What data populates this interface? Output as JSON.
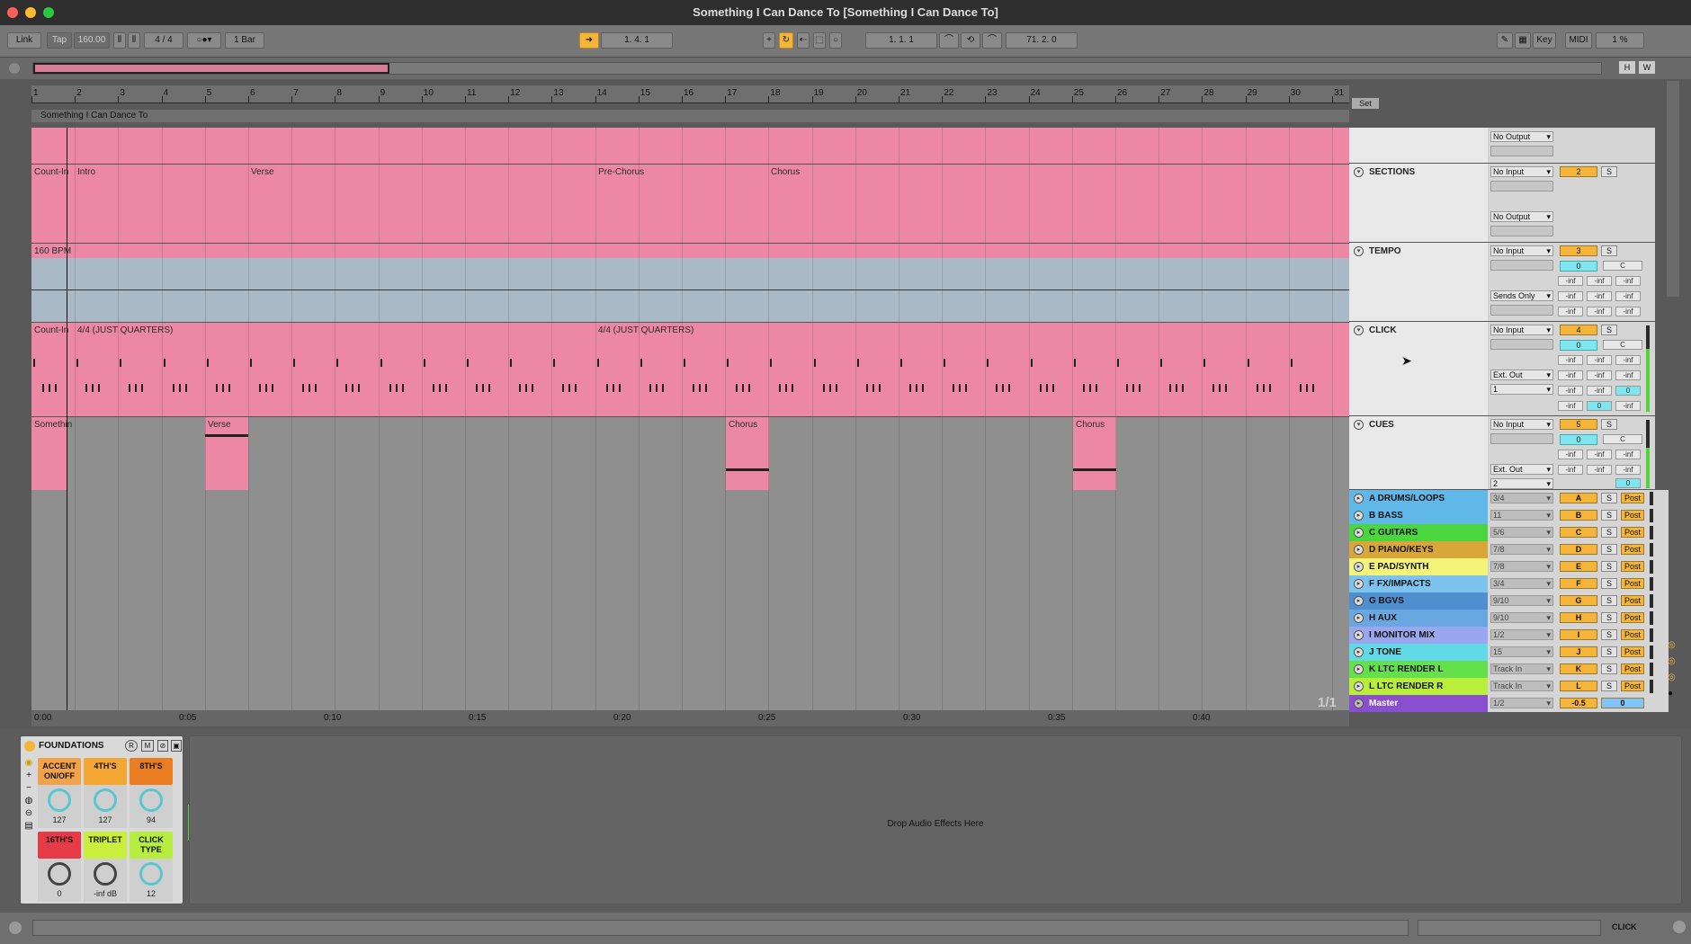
{
  "window": {
    "title": "Something I Can Dance To  [Something I Can Dance To]"
  },
  "control_bar": {
    "link": "Link",
    "tap": "Tap",
    "tempo": "160.00",
    "signature": "4 / 4",
    "quantize": "1 Bar",
    "position": "1.   4.   1",
    "loop_start": "1.   1.   1",
    "loop_length": "71.   2.   0",
    "key": "Key",
    "midi": "MIDI",
    "cpu": "1 %"
  },
  "arrangement": {
    "bars": [
      "1",
      "2",
      "3",
      "4",
      "5",
      "6",
      "7",
      "8",
      "9",
      "10",
      "11",
      "12",
      "13",
      "14",
      "15",
      "16",
      "17",
      "18",
      "19",
      "20",
      "21",
      "22",
      "23",
      "24",
      "25",
      "26",
      "27",
      "28",
      "29",
      "30",
      "31"
    ],
    "set_label": "Set",
    "scene_name": "Something I Can Dance To",
    "sections": {
      "count_in": "Count-In",
      "intro": "Intro",
      "verse": "Verse",
      "pre_chorus": "Pre-Chorus",
      "chorus": "Chorus"
    },
    "tempo_clip": "160 BPM",
    "click_clips": {
      "count_in": "Count-In",
      "quarters_a": "4/4 (JUST QUARTERS)",
      "quarters_b": "4/4 (JUST QUARTERS)"
    },
    "cue_clips": {
      "first": "Somethin",
      "verse": "Verse",
      "chorus_1": "Chorus",
      "chorus_2": "Chorus"
    },
    "timeline": [
      "0:00",
      "0:05",
      "0:10",
      "0:15",
      "0:20",
      "0:25",
      "0:30",
      "0:35",
      "0:40"
    ],
    "page_indicator": "1/1"
  },
  "tracks": [
    {
      "name": "",
      "output": "No Output"
    },
    {
      "name": "SECTIONS",
      "input": "No Input",
      "output": "No Output",
      "number": "2",
      "solo": "S"
    },
    {
      "name": "TEMPO",
      "input": "No Input",
      "sends": "Sends Only",
      "number": "3",
      "solo": "S",
      "pan": "0",
      "center": "C",
      "inf": "-inf"
    },
    {
      "name": "CLICK",
      "input": "No Input",
      "output": "Ext. Out",
      "channel": "1",
      "number": "4",
      "solo": "S",
      "pan": "0",
      "center": "C",
      "inf": "-inf",
      "zero": "0"
    },
    {
      "name": "CUES",
      "input": "No Input",
      "output": "Ext. Out",
      "channel": "2",
      "number": "5",
      "solo": "S",
      "pan": "0",
      "center": "C",
      "inf": "-inf",
      "zero": "0"
    }
  ],
  "group_tracks": [
    {
      "name": "A DRUMS/LOOPS",
      "route": "3/4",
      "letter": "A",
      "solo": "S",
      "post": "Post",
      "color": "#5fb8e8"
    },
    {
      "name": "B BASS",
      "route": "11",
      "letter": "B",
      "solo": "S",
      "post": "Post",
      "color": "#5fb8e8"
    },
    {
      "name": "C GUITARS",
      "route": "5/6",
      "letter": "C",
      "solo": "S",
      "post": "Post",
      "color": "#4bd63f"
    },
    {
      "name": "D PIANO/KEYS",
      "route": "7/8",
      "letter": "D",
      "solo": "S",
      "post": "Post",
      "color": "#d9a63a"
    },
    {
      "name": "E PAD/SYNTH",
      "route": "7/8",
      "letter": "E",
      "solo": "S",
      "post": "Post",
      "color": "#f4f37a"
    },
    {
      "name": "F FX/IMPACTS",
      "route": "3/4",
      "letter": "F",
      "solo": "S",
      "post": "Post",
      "color": "#7cc4ef"
    },
    {
      "name": "G BGVS",
      "route": "9/10",
      "letter": "G",
      "solo": "S",
      "post": "Post",
      "color": "#4f8fd0"
    },
    {
      "name": "H AUX",
      "route": "9/10",
      "letter": "H",
      "solo": "S",
      "post": "Post",
      "color": "#6aa6e0"
    },
    {
      "name": "I MONITOR MIX",
      "route": "1/2",
      "letter": "I",
      "solo": "S",
      "post": "Post",
      "color": "#9aa6ee"
    },
    {
      "name": "J TONE",
      "route": "15",
      "letter": "J",
      "solo": "S",
      "post": "Post",
      "color": "#62d9e6"
    },
    {
      "name": "K LTC RENDER L",
      "route": "Track In",
      "letter": "K",
      "solo": "S",
      "post": "Post",
      "color": "#63e04a"
    },
    {
      "name": "L LTC RENDER R",
      "route": "Track In",
      "letter": "L",
      "solo": "S",
      "post": "Post",
      "color": "#b9ef3a"
    }
  ],
  "master": {
    "name": "Master",
    "route": "1/2",
    "volume": "-0.5",
    "pan": "0",
    "color": "#8a4ed0"
  },
  "device": {
    "title": "FOUNDATIONS",
    "buttons": [
      "R",
      "M"
    ],
    "labels": [
      {
        "label": "ACCENT ON/OFF",
        "value": "127",
        "color": "#f2a24a"
      },
      {
        "label": "4TH'S",
        "value": "127",
        "color": "#f5a733"
      },
      {
        "label": "8TH'S",
        "value": "94",
        "color": "#ea7d22"
      },
      {
        "label": "16TH'S",
        "value": "0",
        "color": "#e63a46"
      },
      {
        "label": "TRIPLET",
        "value": "-inf dB",
        "color": "#c9ef3c"
      },
      {
        "label": "CLICK TYPE",
        "value": "12",
        "color": "#b6ed3f"
      }
    ]
  },
  "drop_area": {
    "text": "Drop Audio Effects Here"
  },
  "status": {
    "track": "CLICK"
  },
  "colors": {
    "clip_pink": "#ec88a5",
    "accent": "#f5b53b"
  }
}
